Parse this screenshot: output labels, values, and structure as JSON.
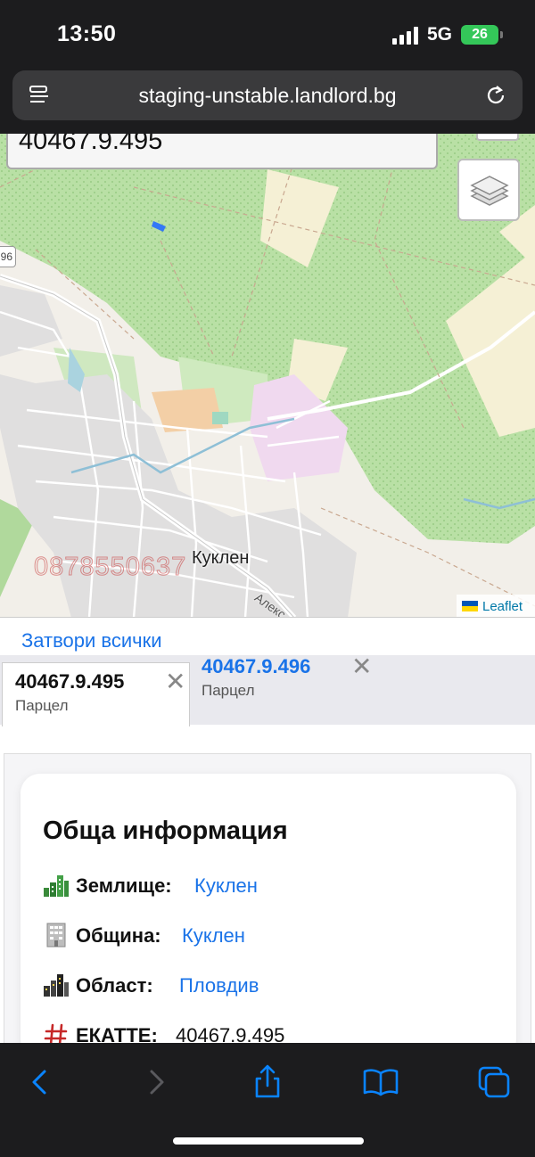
{
  "status_bar": {
    "time": "13:50",
    "network": "5G",
    "battery": "26"
  },
  "browser": {
    "url": "staging-unstable.landlord.bg",
    "icons": [
      "reader-icon",
      "reload-icon",
      "back-icon",
      "forward-icon",
      "share-icon",
      "bookmarks-icon",
      "tabs-icon"
    ]
  },
  "map": {
    "search_value": "40467.9.495",
    "road_badge": "96",
    "town_label": "Куклен",
    "street_label": "Алекс",
    "watermark": "0878550637",
    "attribution": "Leaflet",
    "colors": {
      "forest": "#b7e3a3",
      "field": "#f2efe9",
      "residential": "#e0dfdf",
      "school": "#f0d9f0",
      "road": "#ffffff",
      "water": "#aad3df",
      "parcel": "#3478f6"
    }
  },
  "panel": {
    "close_all": "Затвори всички",
    "tabs": [
      {
        "title": "40467.9.495",
        "subtitle": "Парцел",
        "active": true
      },
      {
        "title": "40467.9.496",
        "subtitle": "Парцел",
        "active": false
      }
    ],
    "card": {
      "title": "Обща информация",
      "rows": [
        {
          "label": "Землище:",
          "value": "Куклен",
          "icon": "city-icon",
          "link": true
        },
        {
          "label": "Община:",
          "value": "Куклен",
          "icon": "office-building-icon",
          "link": true
        },
        {
          "label": "Област:",
          "value": "Пловдив",
          "icon": "cityscape-icon",
          "link": true
        },
        {
          "label": "ЕКАТТЕ:",
          "value": "40467.9.495",
          "icon": "hash-icon",
          "link": false
        }
      ]
    }
  }
}
